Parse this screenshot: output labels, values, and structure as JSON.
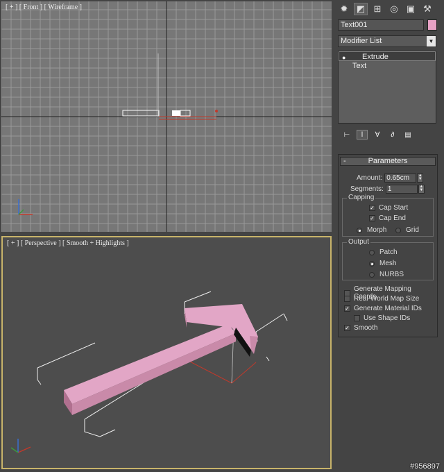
{
  "viewports": {
    "front_label": "[ + ] [ Front ] [ Wireframe ]",
    "perspective_label": "[ + ] [ Perspective ] [ Smooth + Highlights ]"
  },
  "command_panel": {
    "tabs": [
      "create-icon",
      "modify-icon",
      "hierarchy-icon",
      "motion-icon",
      "display-icon",
      "utilities-icon"
    ],
    "object_name": "Text001",
    "object_color": "#e7a2c5",
    "modifier_list": "Modifier List",
    "stack": [
      {
        "label": "Extrude",
        "selected": true
      },
      {
        "label": "Text",
        "selected": false
      }
    ]
  },
  "parameters": {
    "title": "Parameters",
    "amount_label": "Amount:",
    "amount_value": "0.65cm",
    "segments_label": "Segments:",
    "segments_value": "1",
    "capping_title": "Capping",
    "cap_start": "Cap Start",
    "cap_end": "Cap End",
    "morph": "Morph",
    "grid": "Grid",
    "output_title": "Output",
    "patch": "Patch",
    "mesh": "Mesh",
    "nurbs": "NURBS",
    "gen_mapping": "Generate Mapping Coords.",
    "real_world": "Real-World Map Size",
    "gen_material": "Generate Material IDs",
    "use_shape_ids": "Use Shape IDs",
    "smooth": "Smooth"
  },
  "watermark": "#956897"
}
